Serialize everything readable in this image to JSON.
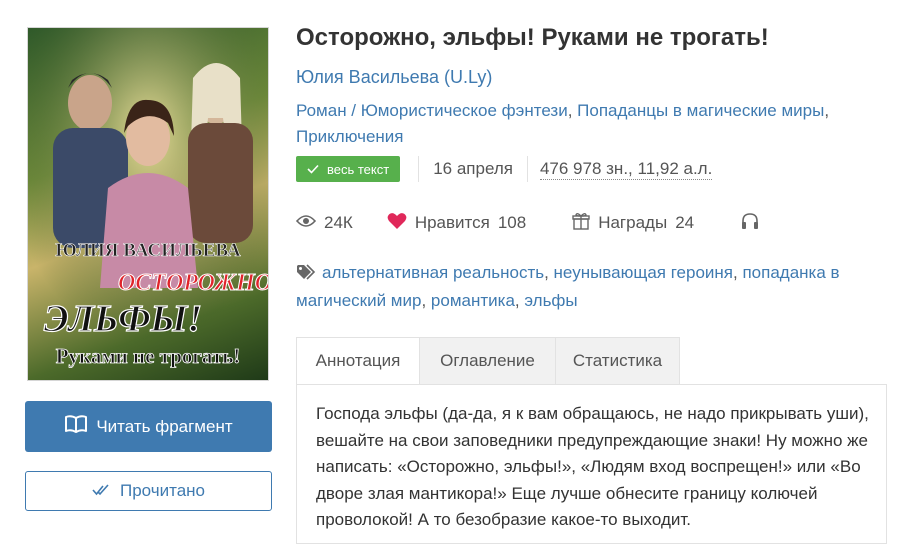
{
  "book": {
    "title": "Осторожно, эльфы! Руками не трогать!",
    "author": "Юлия Васильева (U.Ly)",
    "cover": {
      "author_text": "ЮЛИЯ ВАСИЛЬЕВА",
      "title_line1": "ОСТОРОЖНО,",
      "title_line2": "ЭЛЬФЫ!",
      "title_line3": "Руками не трогать!"
    },
    "genres": [
      {
        "label": "Роман / Юмористическое фэнтези",
        "sep": ", "
      },
      {
        "label": "Попаданцы в магические миры",
        "sep": ","
      },
      {
        "label": "Приключения",
        "sep": ""
      }
    ]
  },
  "meta": {
    "badge": "весь текст",
    "date": "16 апреля",
    "chars": "476 978 зн., 11,92 а.л."
  },
  "stats": {
    "views": "24К",
    "likes_label": "Нравится",
    "likes_count": "108",
    "awards_label": "Награды",
    "awards_count": "24"
  },
  "tags": [
    {
      "label": "альтернативная реальность",
      "sep": ", "
    },
    {
      "label": "неунывающая героиня",
      "sep": ", "
    },
    {
      "label": "попаданка в магический мир",
      "sep": ", "
    },
    {
      "label": "романтика",
      "sep": ", "
    },
    {
      "label": "эльфы",
      "sep": ""
    }
  ],
  "buttons": {
    "read_fragment": "Читать фрагмент",
    "read_done": "Прочитано"
  },
  "tabs": [
    {
      "label": "Аннотация"
    },
    {
      "label": "Оглавление"
    },
    {
      "label": "Статистика"
    }
  ],
  "annotation": "Господа эльфы (да-да, я к вам обращаюсь, не надо прикрывать уши), вешайте на свои заповедники предупреждающие знаки! Ну можно же написать: «Осторожно, эльфы!», «Людям вход воспрещен!» или «Во дворе злая мантикора!» Еще лучше обнесите границу колючей проволокой! А то безобразие какое-то выходит.",
  "colors": {
    "accent": "#3f7ab0",
    "badge": "#57b04c",
    "heart": "#e0285a"
  },
  "icons": {
    "read": "book-open-icon",
    "done": "double-check-icon",
    "badge": "check-icon",
    "views": "eye-icon",
    "likes": "heart-icon",
    "awards": "gift-icon",
    "audio": "headphones-icon",
    "tags": "tag-icon"
  }
}
